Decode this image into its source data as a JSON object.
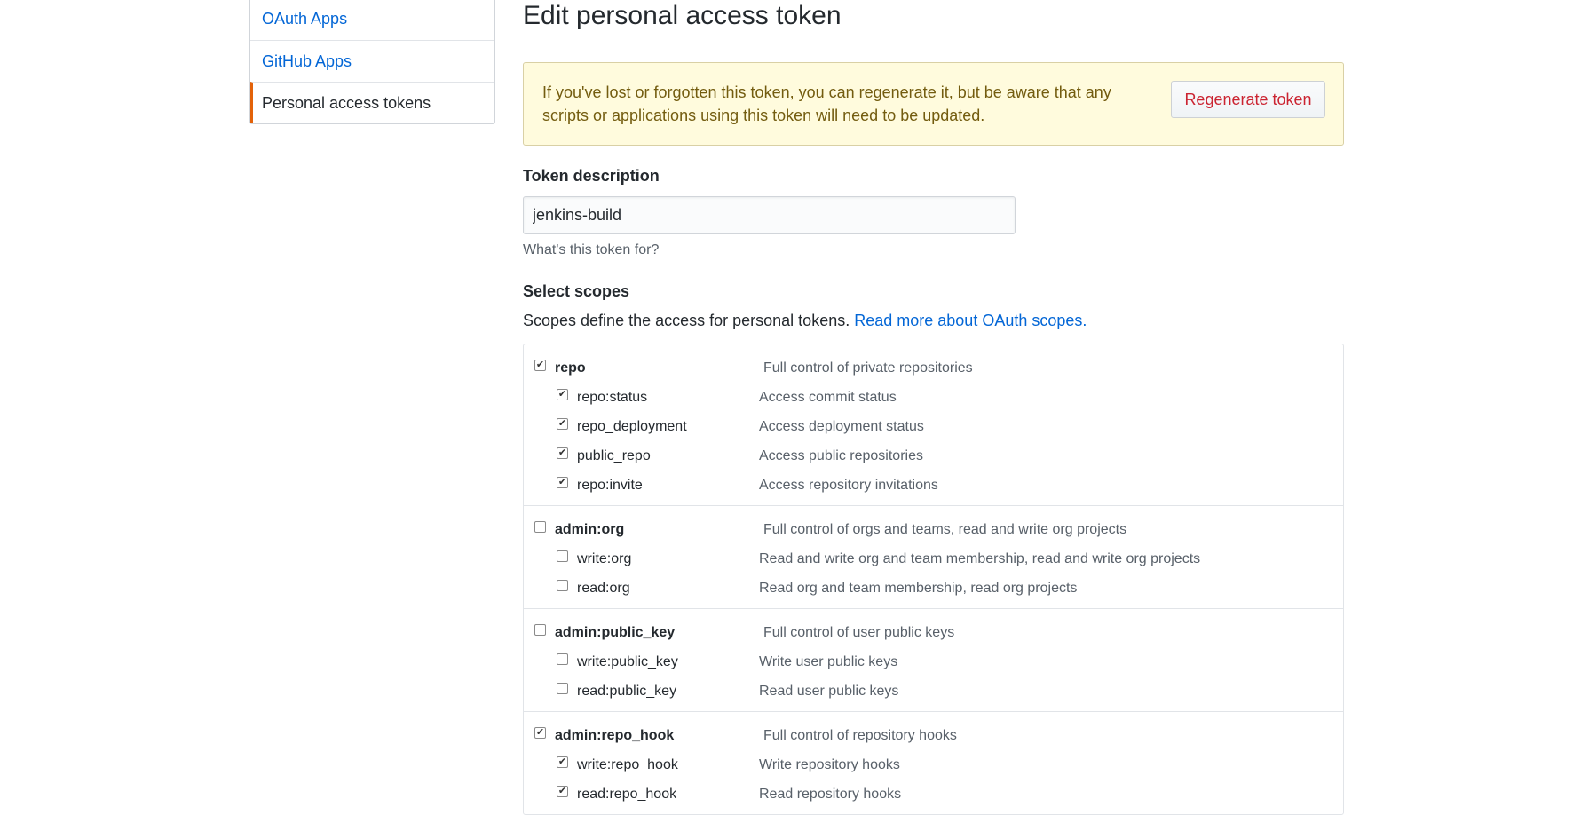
{
  "sidebar": {
    "items": [
      {
        "label": "OAuth Apps"
      },
      {
        "label": "GitHub Apps"
      },
      {
        "label": "Personal access tokens"
      }
    ]
  },
  "page": {
    "title": "Edit personal access token"
  },
  "flash": {
    "message": "If you've lost or forgotten this token, you can regenerate it, but be aware that any scripts or applications using this token will need to be updated.",
    "regenerate_label": "Regenerate token"
  },
  "form": {
    "description_label": "Token description",
    "description_value": "jenkins-build",
    "description_note": "What's this token for?",
    "scopes_label": "Select scopes",
    "scopes_desc": "Scopes define the access for personal tokens.",
    "scopes_link": "Read more about OAuth scopes."
  },
  "scope_groups": [
    {
      "name": "repo",
      "desc": "Full control of private repositories",
      "checked": true,
      "children": [
        {
          "name": "repo:status",
          "desc": "Access commit status",
          "checked": true
        },
        {
          "name": "repo_deployment",
          "desc": "Access deployment status",
          "checked": true
        },
        {
          "name": "public_repo",
          "desc": "Access public repositories",
          "checked": true
        },
        {
          "name": "repo:invite",
          "desc": "Access repository invitations",
          "checked": true
        }
      ]
    },
    {
      "name": "admin:org",
      "desc": "Full control of orgs and teams, read and write org projects",
      "checked": false,
      "children": [
        {
          "name": "write:org",
          "desc": "Read and write org and team membership, read and write org projects",
          "checked": false
        },
        {
          "name": "read:org",
          "desc": "Read org and team membership, read org projects",
          "checked": false
        }
      ]
    },
    {
      "name": "admin:public_key",
      "desc": "Full control of user public keys",
      "checked": false,
      "children": [
        {
          "name": "write:public_key",
          "desc": "Write user public keys",
          "checked": false
        },
        {
          "name": "read:public_key",
          "desc": "Read user public keys",
          "checked": false
        }
      ]
    },
    {
      "name": "admin:repo_hook",
      "desc": "Full control of repository hooks",
      "checked": true,
      "children": [
        {
          "name": "write:repo_hook",
          "desc": "Write repository hooks",
          "checked": true
        },
        {
          "name": "read:repo_hook",
          "desc": "Read repository hooks",
          "checked": true
        }
      ]
    }
  ],
  "colors": {
    "link": "#0366d6",
    "selected_accent": "#e36209",
    "flash_bg": "#fffbdd",
    "danger": "#cb2431"
  }
}
